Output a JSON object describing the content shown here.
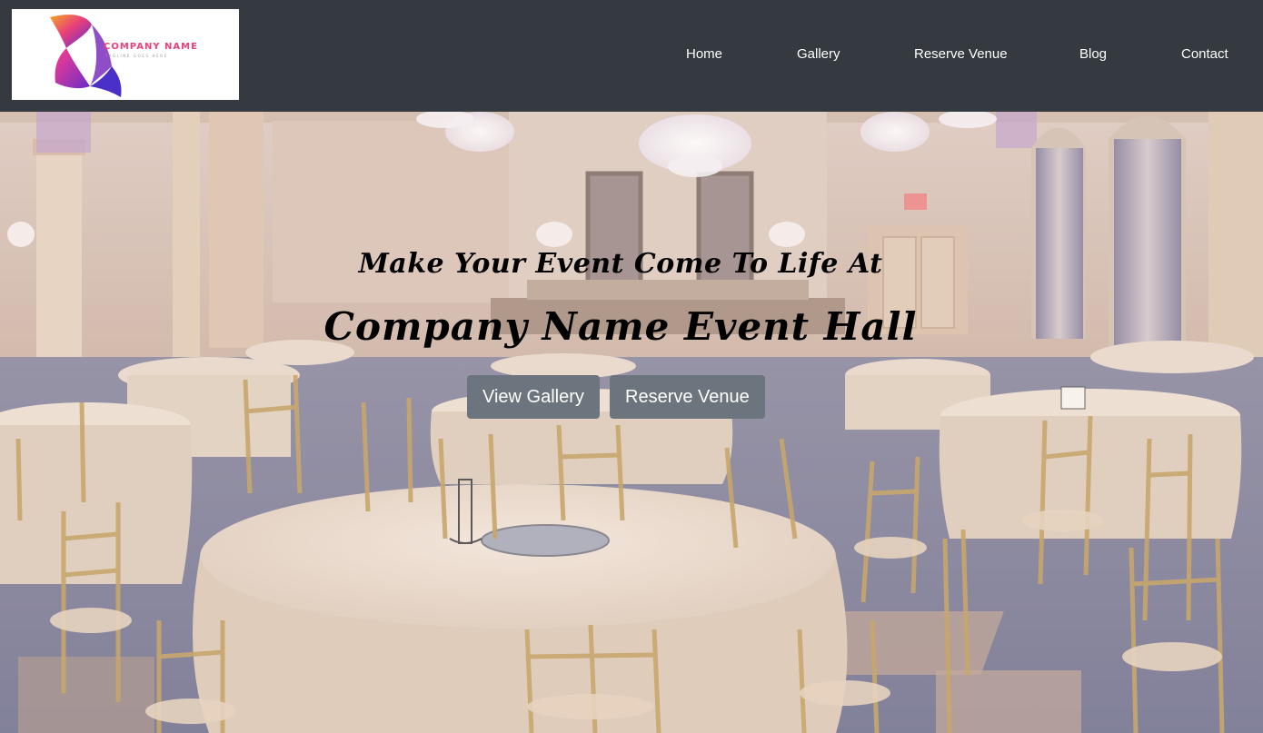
{
  "logo": {
    "company_name": "COMPANY NAME",
    "tagline": "TAGLINE GOES HERE"
  },
  "nav": {
    "items": [
      {
        "label": "Home"
      },
      {
        "label": "Gallery"
      },
      {
        "label": "Reserve Venue"
      },
      {
        "label": "Blog"
      },
      {
        "label": "Contact"
      }
    ]
  },
  "hero": {
    "headline": "Make Your Event Come To Life At",
    "title": "Company Name Event Hall",
    "buttons": [
      {
        "label": "View Gallery"
      },
      {
        "label": "Reserve Venue"
      }
    ]
  },
  "colors": {
    "navbar": "#343a40",
    "button": "#6c757d",
    "logo_gradient_start": "#f6a623",
    "logo_gradient_mid": "#e8407a",
    "logo_gradient_end": "#5b2bd6"
  }
}
